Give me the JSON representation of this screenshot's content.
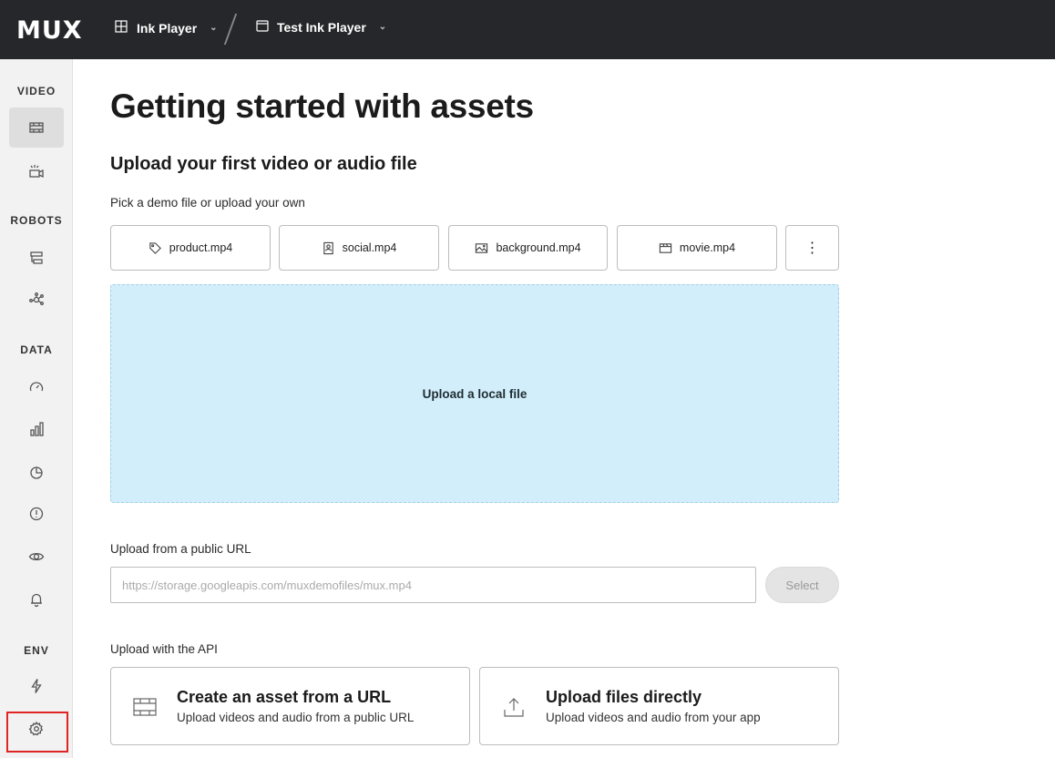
{
  "topbar": {
    "logo": "MUX",
    "org": {
      "label": "Ink Player",
      "icon": "building-icon"
    },
    "env": {
      "label": "Test Ink Player",
      "icon": "calendar-icon"
    },
    "chevron": "⌄"
  },
  "sidebar": {
    "sections": [
      {
        "label": "VIDEO",
        "items": [
          "film-icon",
          "camera-icon"
        ]
      },
      {
        "label": "ROBOTS",
        "items": [
          "workflow-icon",
          "network-icon"
        ]
      },
      {
        "label": "DATA",
        "items": [
          "gauge-icon",
          "bar-chart-icon",
          "pie-chart-icon",
          "alert-icon",
          "eye-icon",
          "bell-icon"
        ]
      },
      {
        "label": "ENV",
        "items": [
          "lightning-icon",
          "gear-icon"
        ]
      }
    ],
    "active_item": "film-icon"
  },
  "main": {
    "title": "Getting started with assets",
    "subtitle": "Upload your first video or audio file",
    "demo_label": "Pick a demo file or upload your own",
    "demo_files": [
      {
        "label": "product.mp4",
        "icon": "tag-icon"
      },
      {
        "label": "social.mp4",
        "icon": "portrait-icon"
      },
      {
        "label": "background.mp4",
        "icon": "image-icon"
      },
      {
        "label": "movie.mp4",
        "icon": "clapper-icon"
      }
    ],
    "more_glyph": "⋮",
    "dropzone_label": "Upload a local file",
    "url_label": "Upload from a public URL",
    "url_placeholder": "https://storage.googleapis.com/muxdemofiles/mux.mp4",
    "select_label": "Select",
    "api_label": "Upload with the API",
    "api_cards": [
      {
        "title": "Create an asset from a URL",
        "subtitle": "Upload videos and audio from a public URL",
        "icon": "film-icon"
      },
      {
        "title": "Upload files directly",
        "subtitle": "Upload videos and audio from your app",
        "icon": "upload-icon"
      }
    ]
  },
  "colors": {
    "topbar": "#26272b",
    "dropzone": "#d2eefa",
    "highlight": "#e02424"
  }
}
